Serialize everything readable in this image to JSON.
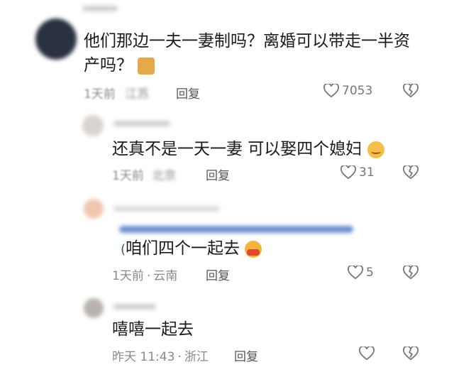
{
  "comments": [
    {
      "text_line1": "他们那边一夫一妻制吗？离婚可以带走一半资",
      "text_line2": "产吗？",
      "time": "1天前",
      "location": "江苏",
      "reply_label": "回复",
      "likes": "7053"
    },
    {
      "text": "还真不是一天一妻 可以娶四个媳妇",
      "time": "1天前",
      "location": "北京",
      "reply_label": "回复",
      "likes": "31"
    },
    {
      "text": "咱们四个一起去",
      "time": "1天前",
      "location": "云南",
      "reply_label": "回复",
      "likes": "5"
    },
    {
      "text": "嘻嘻一起去",
      "time": "昨天 11:43",
      "location": "浙江",
      "reply_label": "回复",
      "likes": ""
    }
  ],
  "icons": {
    "like": "heart-outline-icon",
    "dislike": "broken-heart-icon"
  },
  "colors": {
    "text": "#1a1a1a",
    "meta": "#8a8a8a",
    "icon": "#777777"
  }
}
